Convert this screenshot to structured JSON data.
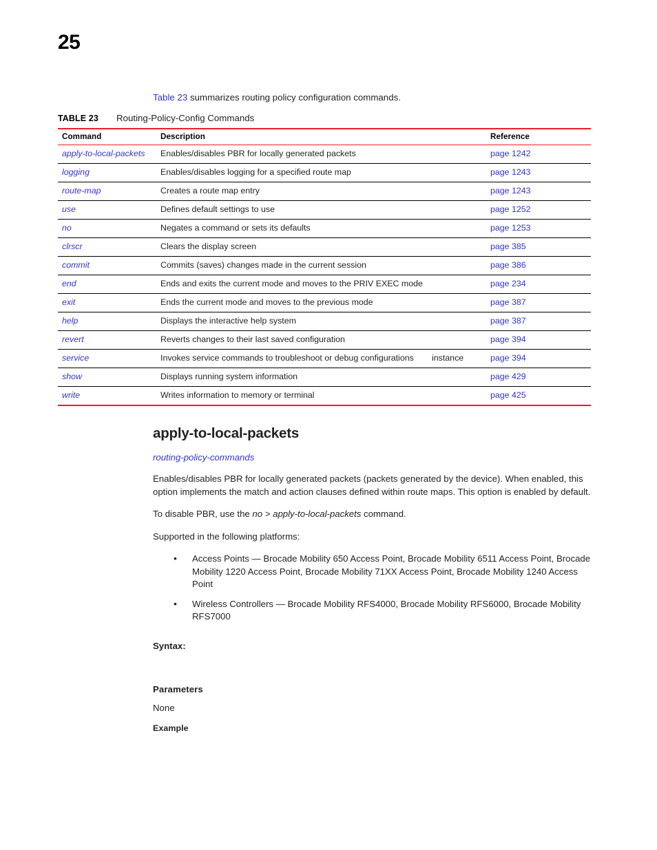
{
  "page": {
    "number": "25"
  },
  "intro": {
    "link_text": "Table 23",
    "rest_text": " summarizes routing policy configuration commands."
  },
  "table_caption": {
    "label": "TABLE 23",
    "title": "Routing-Policy-Config Commands"
  },
  "table": {
    "columns": [
      "Command",
      "Description",
      "",
      "Reference"
    ],
    "rows": [
      {
        "command": "apply-to-local-packets",
        "description": "Enables/disables PBR for locally generated packets",
        "extra": "",
        "reference": "page 1242"
      },
      {
        "command": "logging",
        "description": "Enables/disables logging for a specified route map",
        "extra": "",
        "reference": "page 1243"
      },
      {
        "command": "route-map",
        "description": "Creates a route map entry",
        "extra": "",
        "reference": "page 1243"
      },
      {
        "command": "use",
        "description": "Defines default settings to use",
        "extra": "",
        "reference": "page 1252"
      },
      {
        "command": "no",
        "description": "Negates a command or sets its defaults",
        "extra": "",
        "reference": "page 1253"
      },
      {
        "command": "clrscr",
        "description": "Clears the display screen",
        "extra": "",
        "reference": "page 385"
      },
      {
        "command": "commit",
        "description": "Commits (saves) changes made in the current session",
        "extra": "",
        "reference": "page 386"
      },
      {
        "command": "end",
        "description": "Ends and exits the current mode and moves to the PRIV EXEC mode",
        "extra": "",
        "reference": "page 234"
      },
      {
        "command": "exit",
        "description": "Ends the current mode and moves to the previous mode",
        "extra": "",
        "reference": "page 387"
      },
      {
        "command": "help",
        "description": "Displays the interactive help system",
        "extra": "",
        "reference": "page 387"
      },
      {
        "command": "revert",
        "description": "Reverts changes to their last saved configuration",
        "extra": "",
        "reference": "page 394"
      },
      {
        "command": "service",
        "description": "Invokes service commands to troubleshoot or debug configurations",
        "extra": "instance",
        "reference": "page 394"
      },
      {
        "command": "show",
        "description": "Displays running system information",
        "extra": "",
        "reference": "page 429"
      },
      {
        "command": "write",
        "description": "Writes information to memory or terminal",
        "extra": "",
        "reference": "page 425"
      }
    ]
  },
  "section": {
    "heading": "apply-to-local-packets",
    "subtitle": "routing-policy-commands",
    "description": "Enables/disables PBR for locally generated packets (packets generated by the device). When enabled, this option implements the match and action clauses defined within route maps. This option is enabled by default.",
    "disable_note": {
      "prefix": "To disable PBR, use the ",
      "italic_command": "no > apply-to-local-packets",
      "suffix": " command."
    },
    "platforms_intro": "Supported in the following platforms:",
    "platforms": [
      "Access Points — Brocade Mobility 650 Access Point, Brocade Mobility 6511 Access Point, Brocade Mobility 1220 Access Point, Brocade Mobility 71XX Access Point, Brocade Mobility 1240 Access Point",
      "Wireless Controllers — Brocade Mobility RFS4000, Brocade Mobility RFS6000, Brocade Mobility RFS7000"
    ]
  },
  "syntax": {
    "label": "Syntax:",
    "value": ""
  },
  "parameters": {
    "label": "Parameters",
    "value": "None"
  },
  "example": {
    "label": "Example"
  },
  "colors": {
    "link_blue": "#3333cc",
    "rule_red": "#ed1c24",
    "body_text": "#231f20"
  }
}
